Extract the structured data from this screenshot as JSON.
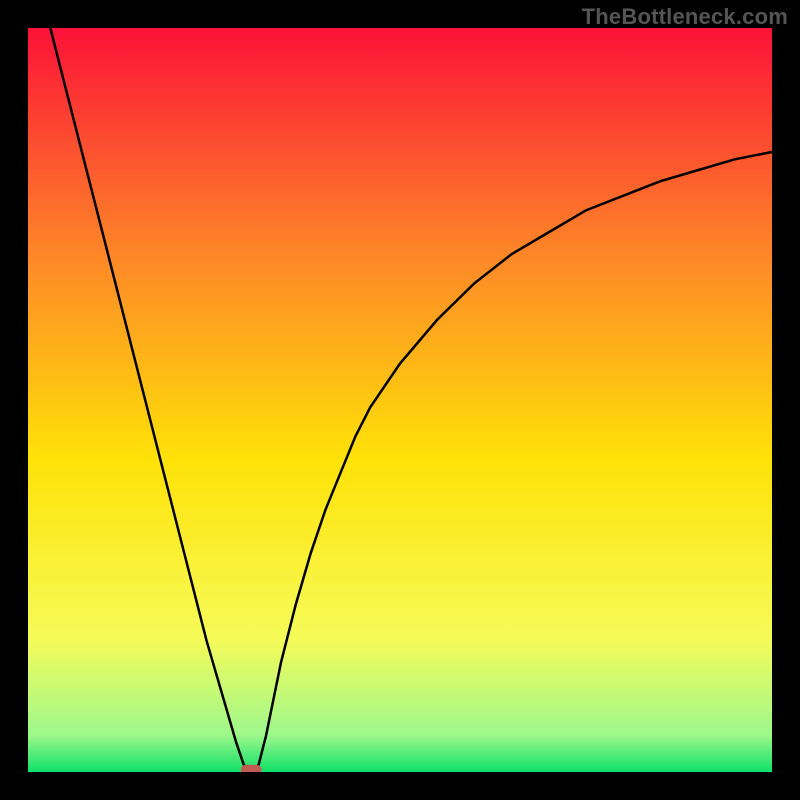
{
  "watermark": "TheBottleneck.com",
  "chart_data": {
    "type": "line",
    "title": "",
    "xlabel": "",
    "ylabel": "",
    "xlim": [
      0,
      100
    ],
    "ylim": [
      0,
      102
    ],
    "grid": false,
    "legend": false,
    "background_gradient": {
      "top": "#fb1238",
      "upper_mid": "#fd8528",
      "mid": "#ffe208",
      "lower_mid": "#f6fb58",
      "near_bottom": "#9ef88c",
      "bottom": "#10e068"
    },
    "series": [
      {
        "name": "bottleneck-curve",
        "color": "#000000",
        "x": [
          0,
          2,
          4,
          6,
          8,
          10,
          12,
          14,
          16,
          18,
          20,
          22,
          24,
          26,
          28,
          29,
          30,
          31,
          32,
          33,
          34,
          36,
          38,
          40,
          42,
          44,
          46,
          48,
          50,
          55,
          60,
          65,
          70,
          75,
          80,
          85,
          90,
          95,
          100
        ],
        "values": [
          114,
          106,
          98,
          90,
          82,
          74,
          66,
          58,
          50,
          42,
          34,
          26,
          18,
          11,
          4,
          1,
          0,
          1,
          5,
          10,
          15,
          23,
          30,
          36,
          41,
          46,
          50,
          53,
          56,
          62,
          67,
          71,
          74,
          77,
          79,
          81,
          82.5,
          84,
          85
        ]
      }
    ],
    "marker": {
      "name": "optimal-point",
      "shape": "rounded-rect",
      "color": "#c05a52",
      "x": 30,
      "y": 0,
      "width_frac": 0.028,
      "height_frac": 0.014
    }
  }
}
